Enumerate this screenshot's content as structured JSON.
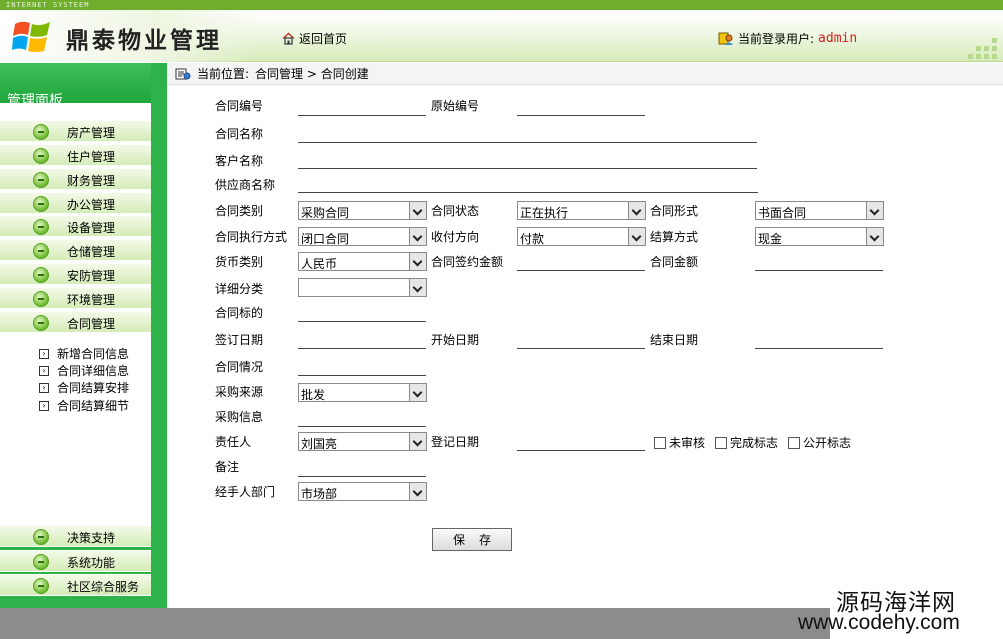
{
  "header": {
    "banner_text": "INTERNET SYSTEEM",
    "brand": "鼎泰物业管理",
    "home_label": "返回首页",
    "user_prefix": "当前登录用户:",
    "user_name": "admin"
  },
  "sidebar": {
    "title": "管理面板",
    "menu": [
      "房产管理",
      "住户管理",
      "财务管理",
      "办公管理",
      "设备管理",
      "仓储管理",
      "安防管理",
      "环境管理",
      "合同管理"
    ],
    "submenu": [
      "新增合同信息",
      "合同详细信息",
      "合同结算安排",
      "合同结算细节"
    ],
    "bottom_menu": [
      "决策支持",
      "系统功能",
      "社区综合服务"
    ]
  },
  "breadcrumb": {
    "prefix": "当前位置:",
    "path": "合同管理 > 合同创建"
  },
  "form": {
    "labels": {
      "contract_no": "合同编号",
      "original_no": "原始编号",
      "contract_name": "合同名称",
      "customer_name": "客户名称",
      "supplier_name": "供应商名称",
      "contract_type": "合同类别",
      "contract_status": "合同状态",
      "contract_form": "合同形式",
      "exec_method": "合同执行方式",
      "pay_direction": "收付方向",
      "settle_method": "结算方式",
      "currency": "货币类别",
      "sign_amount": "合同签约金额",
      "contract_amount": "合同金额",
      "detail_category": "详细分类",
      "subject": "合同标的",
      "sign_date": "签订日期",
      "start_date": "开始日期",
      "end_date": "结束日期",
      "situation": "合同情况",
      "purchase_source": "采购来源",
      "purchase_info": "采购信息",
      "responsible": "责任人",
      "register_date": "登记日期",
      "remark": "备注",
      "handler_dept": "经手人部门"
    },
    "values": {
      "contract_type": "采购合同",
      "contract_status": "正在执行",
      "contract_form": "书面合同",
      "exec_method": "闭口合同",
      "pay_direction": "付款",
      "settle_method": "现金",
      "currency": "人民币",
      "detail_category": "",
      "purchase_source": "批发",
      "responsible": "刘国亮",
      "handler_dept": "市场部"
    },
    "checkboxes": [
      "未审核",
      "完成标志",
      "公开标志"
    ],
    "save_label": "保存"
  },
  "watermark": {
    "line1": "源码海洋网",
    "line2": "www.codehy.com"
  }
}
